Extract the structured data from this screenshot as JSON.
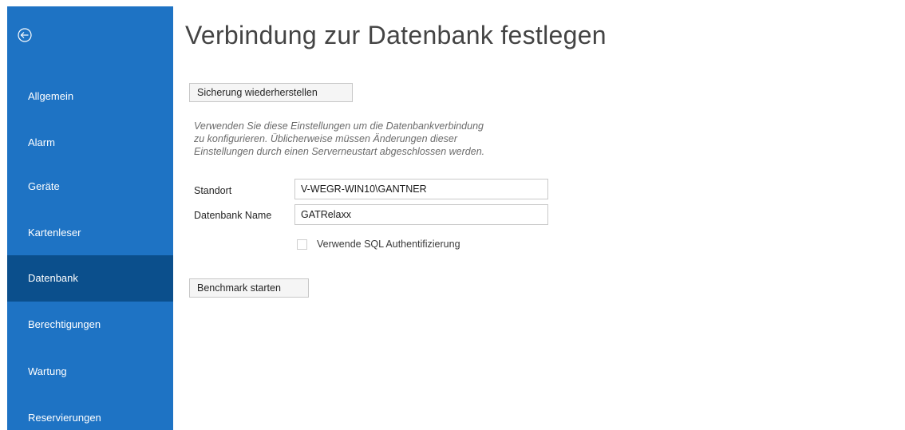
{
  "sidebar": {
    "back_icon": "back-arrow-circle-icon",
    "accent_color": "#1e73c4",
    "selected_color": "#0b4f8c",
    "items": [
      {
        "label": "Allgemein",
        "selected": false
      },
      {
        "label": "Alarm",
        "selected": false
      },
      {
        "label": "Geräte",
        "selected": false
      },
      {
        "label": "Kartenleser",
        "selected": false
      },
      {
        "label": "Datenbank",
        "selected": true
      },
      {
        "label": "Berechtigungen",
        "selected": false
      },
      {
        "label": "Wartung",
        "selected": false
      },
      {
        "label": "Reservierungen",
        "selected": false
      }
    ]
  },
  "main": {
    "title": "Verbindung zur Datenbank festlegen",
    "restore_button": "Sicherung wiederherstellen",
    "description_lines": [
      "Verwenden Sie diese Einstellungen um die Datenbankverbindung",
      "zu konfigurieren. Üblicherweise müssen Änderungen dieser",
      "Einstellungen durch einen Serverneustart abgeschlossen werden."
    ],
    "fields": {
      "standort_label": "Standort",
      "standort_value": "V-WEGR-WIN10\\GANTNER",
      "dbname_label": "Datenbank Name",
      "dbname_value": "GATRelaxx"
    },
    "sql_auth": {
      "label": "Verwende SQL Authentifizierung",
      "checked": false
    },
    "benchmark_button": "Benchmark starten"
  }
}
